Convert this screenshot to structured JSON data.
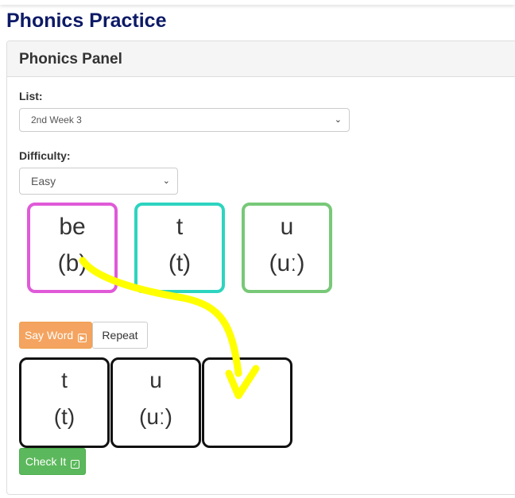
{
  "page": {
    "title": "Phonics Practice"
  },
  "panel": {
    "title": "Phonics Panel",
    "list_label": "List:",
    "list_value": "2nd Week 3",
    "difficulty_label": "Difficulty:",
    "difficulty_value": "Easy"
  },
  "tiles": [
    {
      "grapheme": "be",
      "sound": "(b)",
      "color": "#e05ad8"
    },
    {
      "grapheme": "t",
      "sound": "(t)",
      "color": "#2dd4bf"
    },
    {
      "grapheme": "u",
      "sound": "(uː)",
      "color": "#78c878"
    }
  ],
  "buttons": {
    "say_word": "Say Word",
    "repeat": "Repeat",
    "check_it": "Check It"
  },
  "slots": [
    {
      "grapheme": "t",
      "sound": "(t)"
    },
    {
      "grapheme": "u",
      "sound": "(uː)"
    },
    {
      "grapheme": "",
      "sound": ""
    }
  ],
  "colors": {
    "title": "#0d1a66",
    "say_button": "#f4a460",
    "check_button": "#5cb85c",
    "annotation_arrow": "#ffff00"
  },
  "icons": {
    "say_word": "play-icon",
    "check_it": "check-square-icon",
    "select": "chevron-down-icon"
  }
}
